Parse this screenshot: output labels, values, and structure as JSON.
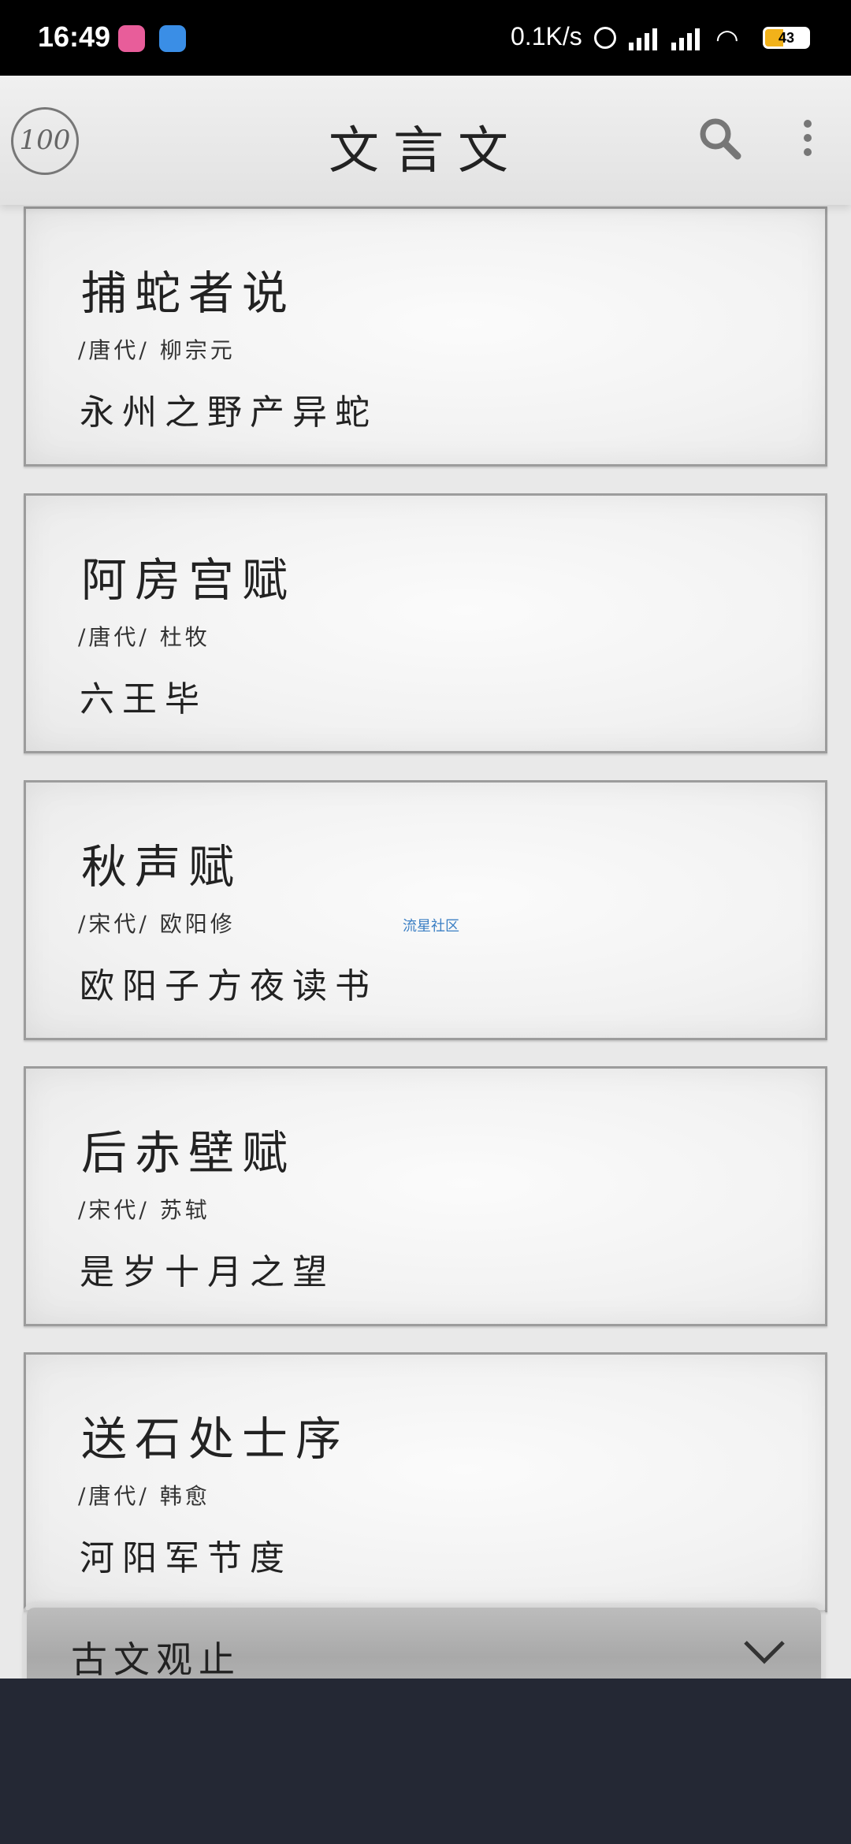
{
  "status_bar": {
    "time": "16:49",
    "net_speed": "0.1K/s",
    "battery": "43"
  },
  "app_bar": {
    "logo_text": "100",
    "title": "文言文"
  },
  "articles": [
    {
      "title": "捕蛇者说",
      "meta": "/唐代/ 柳宗元",
      "first_line": "永州之野产异蛇"
    },
    {
      "title": "阿房宫赋",
      "meta": "/唐代/ 杜牧",
      "first_line": "六王毕"
    },
    {
      "title": "秋声赋",
      "meta": "/宋代/ 欧阳修",
      "first_line": "欧阳子方夜读书"
    },
    {
      "title": "后赤壁赋",
      "meta": "/宋代/ 苏轼",
      "first_line": "是岁十月之望"
    },
    {
      "title": "送石处士序",
      "meta": "/唐代/ 韩愈",
      "first_line": "河阳军节度"
    }
  ],
  "watermark": "流星社区",
  "category_selector": {
    "label": "古文观止"
  }
}
